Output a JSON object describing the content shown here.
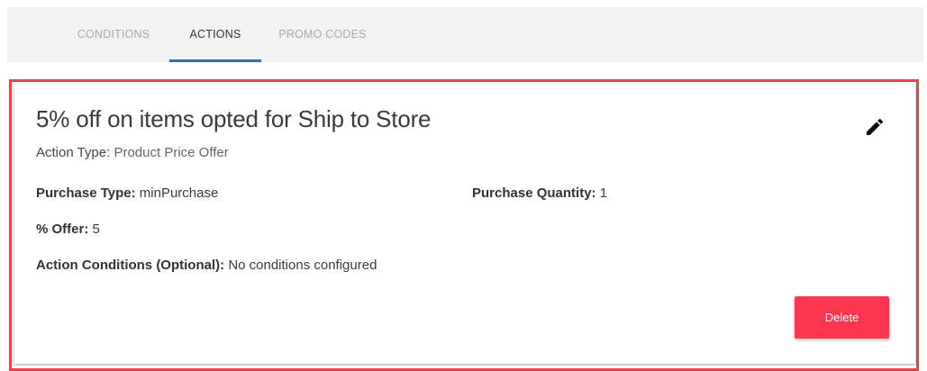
{
  "tabs": [
    {
      "label": "CONDITIONS",
      "active": false
    },
    {
      "label": "ACTIONS",
      "active": true
    },
    {
      "label": "PROMO CODES",
      "active": false
    }
  ],
  "card": {
    "title": "5% off on items opted for Ship to Store",
    "action_type_label": "Action Type:",
    "action_type_value": "Product Price Offer",
    "purchase_type_label": "Purchase Type:",
    "purchase_type_value": "minPurchase",
    "purchase_quantity_label": "Purchase Quantity:",
    "purchase_quantity_value": "1",
    "offer_label": "% Offer:",
    "offer_value": "5",
    "action_conditions_label": "Action Conditions (Optional):",
    "action_conditions_value": "No conditions configured",
    "edit_icon": "pencil-icon",
    "delete_label": "Delete"
  },
  "colors": {
    "tab_indicator": "#2f6fb6",
    "highlight_border": "#e8424f",
    "delete_button": "#ff364f"
  }
}
